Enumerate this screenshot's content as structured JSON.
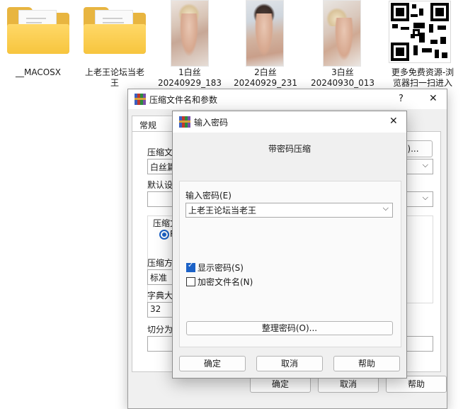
{
  "desktop": {
    "files": [
      {
        "name": "__MACOSX",
        "type": "folder"
      },
      {
        "name": "上老王论坛当老\n王",
        "type": "folder"
      },
      {
        "name": "1白丝\n20240929_183",
        "type": "image"
      },
      {
        "name": "2白丝\n20240929_231",
        "type": "image"
      },
      {
        "name": "3白丝\n20240930_013",
        "type": "image"
      },
      {
        "name": "更多免费资源-浏\n览器扫一扫进入",
        "type": "qr-image"
      }
    ]
  },
  "archive_dialog": {
    "title": "压缩文件名和参数",
    "help_icon": "?",
    "close_icon": "✕",
    "tab_general": "常规",
    "label_archive_name": "压缩文",
    "archive_name_value": "白丝篇",
    "browse_button": "(B)...",
    "label_default_settings": "默认设",
    "label_format": "压缩文",
    "format_option": "R",
    "label_method": "压缩方",
    "method_value": "标准",
    "label_dictionary": "字典大",
    "dictionary_value": "32",
    "label_split": "切分为",
    "ok_button": "确定",
    "cancel_button": "取消",
    "help_button": "帮助"
  },
  "password_dialog": {
    "title": "输入密码",
    "close_icon": "✕",
    "heading": "带密码压缩",
    "label_password": "输入密码(E)",
    "password_value": "上老王论坛当老王",
    "show_password_label": "显示密码(S)",
    "show_password_checked": true,
    "encrypt_filenames_label": "加密文件名(N)",
    "encrypt_filenames_checked": false,
    "organize_button": "整理密码(O)...",
    "ok_button": "确定",
    "cancel_button": "取消",
    "help_button": "帮助"
  },
  "colors": {
    "accent": "#1c62c7",
    "folder": "#f7c53e"
  }
}
